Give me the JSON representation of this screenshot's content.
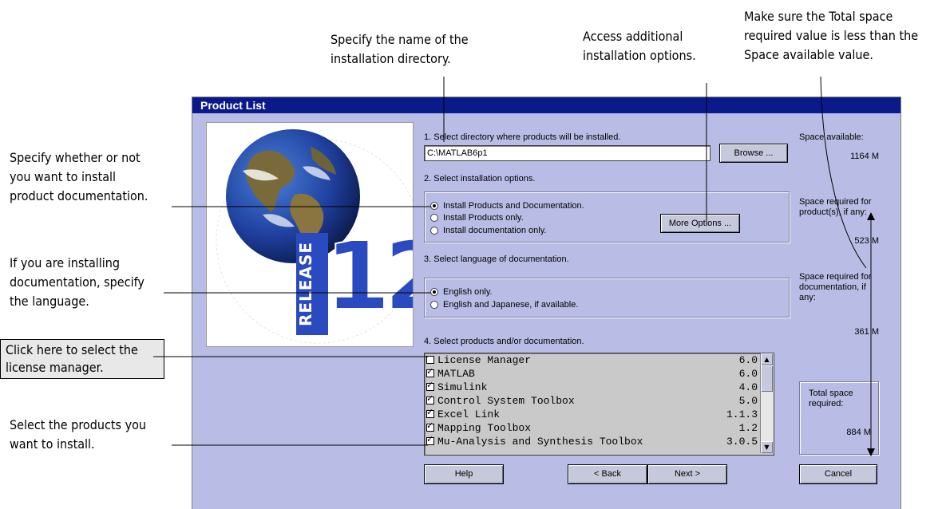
{
  "annotations": {
    "install_dir": "Specify the name of the\ninstallation directory.",
    "more_options": "Access additional\ninstallation options.",
    "space": "Make sure the Total space\nrequired value is less than the\nSpace available value.",
    "documentation": "Specify whether or not\nyou want to install\nproduct documentation.",
    "language": "If you are installing\ndocumentation, specify\nthe language.",
    "license": "Click here to select the\nlicense manager.",
    "products": "Select the products you\nwant to install."
  },
  "dialog": {
    "title": "Product List",
    "release_label": "RELEASE",
    "release_number": "12"
  },
  "step1": {
    "label": "1. Select directory where products will be installed.",
    "directory_value": "C:\\MATLAB6p1",
    "browse_label": "Browse ..."
  },
  "step2": {
    "label": "2. Select installation options.",
    "options": [
      {
        "label": "Install Products and Documentation.",
        "selected": true
      },
      {
        "label": "Install Products only.",
        "selected": false
      },
      {
        "label": "Install documentation only.",
        "selected": false
      }
    ],
    "more_options_label": "More Options ..."
  },
  "step3": {
    "label": "3. Select language of documentation.",
    "options": [
      {
        "label": "English only.",
        "selected": true
      },
      {
        "label": "English and Japanese, if available.",
        "selected": false
      }
    ]
  },
  "step4": {
    "label": "4. Select products and/or documentation.",
    "products": [
      {
        "name": "License Manager",
        "version": "6.0",
        "checked": false
      },
      {
        "name": "MATLAB",
        "version": "6.0",
        "checked": true
      },
      {
        "name": "Simulink",
        "version": "4.0",
        "checked": true
      },
      {
        "name": "Control System Toolbox",
        "version": "5.0",
        "checked": true
      },
      {
        "name": "Excel Link",
        "version": "1.1.3",
        "checked": true
      },
      {
        "name": "Mapping Toolbox",
        "version": "1.2",
        "checked": true
      },
      {
        "name": "Mu-Analysis and Synthesis Toolbox",
        "version": "3.0.5",
        "checked": true
      }
    ]
  },
  "space": {
    "available_label": "Space available:",
    "available_value": "1164 M",
    "products_label": "Space required for product(s), if any:",
    "products_value": "523 M",
    "documentation_label": "Space required for documentation, if any:",
    "documentation_value": "361 M",
    "total_label": "Total space required:",
    "total_value": "884 M"
  },
  "buttons": {
    "help": "Help",
    "back": "< Back",
    "next": "Next >",
    "cancel": "Cancel"
  }
}
